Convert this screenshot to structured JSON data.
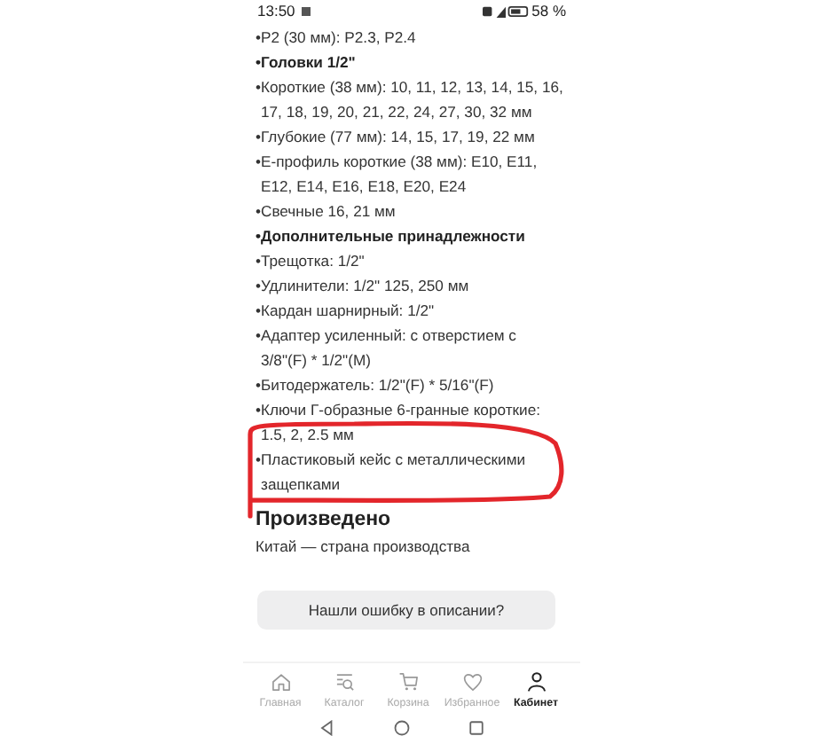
{
  "status_bar": {
    "time": "13:50",
    "battery": "58 %"
  },
  "description": [
    {
      "kind": "item",
      "lines": [
        "•P2 (30 мм): P2.3, P2.4"
      ]
    },
    {
      "kind": "heading",
      "lines": [
        "•Головки 1/2\""
      ]
    },
    {
      "kind": "item",
      "lines": [
        "•Короткие (38 мм): 10, 11, 12, 13, 14, 15, 16,",
        "17, 18, 19, 20, 21, 22, 24, 27, 30, 32 мм"
      ]
    },
    {
      "kind": "item",
      "lines": [
        "•Глубокие (77 мм): 14, 15, 17, 19, 22 мм"
      ]
    },
    {
      "kind": "item",
      "lines": [
        "•Е-профиль короткие (38 мм): E10, E11,",
        "E12, E14, E16, E18, E20, E24"
      ]
    },
    {
      "kind": "item",
      "lines": [
        "•Свечные 16, 21 мм"
      ]
    },
    {
      "kind": "heading",
      "lines": [
        "•Дополнительные принадлежности"
      ]
    },
    {
      "kind": "item",
      "lines": [
        "•Трещотка: 1/2\""
      ]
    },
    {
      "kind": "item",
      "lines": [
        "•Удлинители: 1/2\" 125, 250 мм"
      ]
    },
    {
      "kind": "item",
      "lines": [
        "•Кардан шарнирный: 1/2\""
      ]
    },
    {
      "kind": "item",
      "lines": [
        "•Адаптер усиленный: с отверстием с",
        "3/8\"(F) * 1/2\"(M)"
      ]
    },
    {
      "kind": "item",
      "lines": [
        "•Битодержатель: 1/2\"(F) * 5/16\"(F)"
      ]
    },
    {
      "kind": "item",
      "lines": [
        "•Ключи Г-образные 6-гранные короткие:",
        "1.5, 2, 2.5 мм"
      ]
    },
    {
      "kind": "item",
      "lines": [
        "•Пластиковый кейс с металлическими",
        "защепками"
      ]
    }
  ],
  "origin": {
    "title": "Произведено",
    "text": "Китай — страна производства"
  },
  "report_button": "Нашли ошибку в описании?",
  "bottom_nav": [
    {
      "kind": "home",
      "label": "Главная",
      "selected": false
    },
    {
      "kind": "catalog",
      "label": "Каталог",
      "selected": false
    },
    {
      "kind": "cart",
      "label": "Корзина",
      "selected": false
    },
    {
      "kind": "heart",
      "label": "Избранное",
      "selected": false
    },
    {
      "kind": "person",
      "label": "Кабинет",
      "selected": true
    }
  ]
}
